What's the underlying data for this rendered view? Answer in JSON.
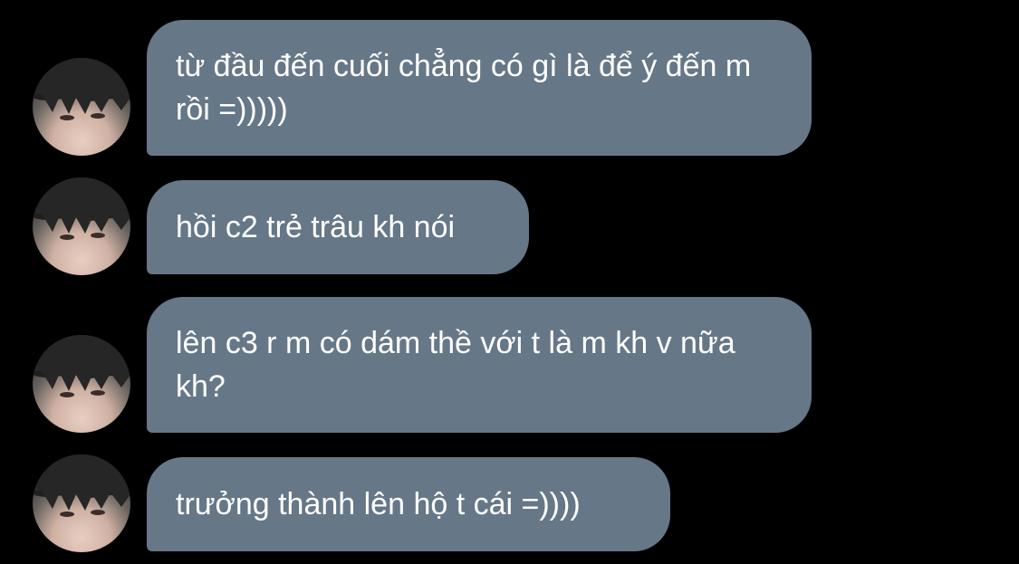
{
  "chat": {
    "theme": {
      "bubble_color": "#667787",
      "background": "#000000",
      "text_color": "#ffffff"
    },
    "messages": [
      {
        "text": "từ đầu đến cuối chẳng có gì là để ý đến m rồi =)))))",
        "avatar": "user-avatar"
      },
      {
        "text": "hồi c2 trẻ trâu kh nói",
        "avatar": "user-avatar"
      },
      {
        "text": "lên c3 r m có dám thề với t là m kh v nữa kh?",
        "avatar": "user-avatar"
      },
      {
        "text": "trưởng thành lên hộ t cái =))))",
        "avatar": "user-avatar"
      }
    ]
  }
}
